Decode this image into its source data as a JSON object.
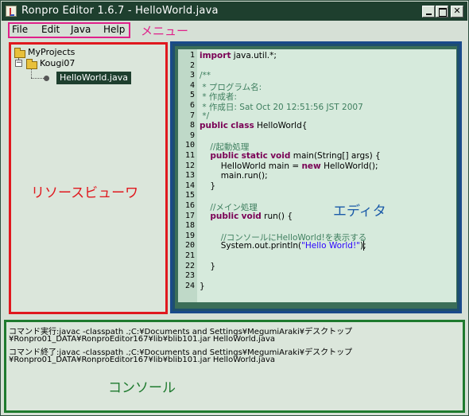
{
  "window": {
    "title": "Ronpro Editor 1.6.7 - HelloWorld.java"
  },
  "menu": {
    "items": [
      "File",
      "Edit",
      "Java",
      "Help"
    ],
    "annotation": "メニュー"
  },
  "resource_viewer": {
    "annotation": "リソースビューワ",
    "tree": [
      {
        "label": "MyProjects",
        "type": "folder",
        "level": 0
      },
      {
        "label": "Kougi07",
        "type": "folder",
        "level": 1,
        "expanded": true
      },
      {
        "label": "HelloWorld.java",
        "type": "file",
        "level": 2,
        "selected": true
      }
    ]
  },
  "editor": {
    "annotation": "エディタ",
    "line_numbers": [
      "1",
      "2",
      "3",
      "4",
      "5",
      "6",
      "7",
      "8",
      "9",
      "10",
      "11",
      "12",
      "13",
      "14",
      "15",
      "16",
      "17",
      "18",
      "19",
      "20",
      "21",
      "22",
      "23",
      "24"
    ],
    "lines": [
      "import java.util.*;",
      "",
      "/**",
      " * プログラム名:",
      " * 作成者:",
      " * 作成日: Sat Oct 20 12:51:56 JST 2007",
      " */",
      "public class HelloWorld{",
      "",
      "    //起動処理",
      "    public static void main(String[] args) {",
      "        HelloWorld main = new HelloWorld();",
      "        main.run();",
      "    }",
      "",
      "    //メイン処理",
      "    public void run() {",
      "",
      "        //コンソールにHelloWorld!を表示する",
      "        System.out.println(\"Hello World!\");",
      "",
      "    }",
      "",
      "}"
    ]
  },
  "console": {
    "annotation": "コンソール",
    "lines": [
      "コマンド実行:javac -classpath .;C:¥Documents and Settings¥MegumiAraki¥デスクトップ",
      "¥Ronpro01_DATA¥RonproEditor167¥lib¥blib101.jar HelloWorld.java",
      "コマンド終了:javac -classpath .;C:¥Documents and Settings¥MegumiAraki¥デスクトップ",
      "¥Ronpro01_DATA¥RonproEditor167¥lib¥blib101.jar HelloWorld.java"
    ]
  },
  "colors": {
    "title_bar": "#1e3f2e",
    "menu_highlight": "#e0208a",
    "resource_highlight": "#e0181e",
    "editor_highlight": "#1a5aa8",
    "console_highlight": "#1e7a2e",
    "keyword": "#7a0055",
    "comment": "#3f7f5f",
    "string": "#2a00ff"
  }
}
